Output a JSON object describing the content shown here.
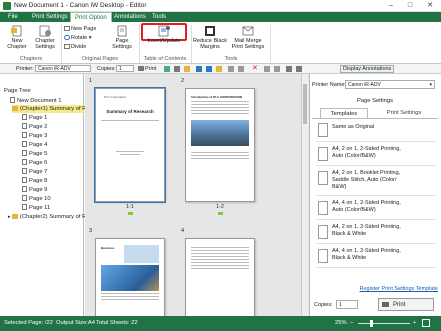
{
  "window": {
    "title": "New Document 1 - Canon iW Desktop - Editor"
  },
  "tabs": [
    "File",
    "Print Settings",
    "Print Option",
    "Annotations",
    "Tools"
  ],
  "ribbon": {
    "new_chapter": "New\nChapter",
    "chapter_settings": "Chapter\nSettings",
    "group_chapters": "Chapters",
    "new_page": "New Page",
    "rotate": "Rotate",
    "divide": "Divide",
    "page_settings": "Page\nSettings",
    "group_original_pages": "Original Pages",
    "insert_update": "Insert/Update",
    "group_table_of_contents": "Table of Contents",
    "reduce_black_margins": "Reduce Black\nMargins",
    "mail_merge_print_settings": "Mail Merge\nPrint Settings",
    "group_tools": "Tools"
  },
  "toolbar": {
    "printer_label": "Printer:",
    "printer_value": "Canon iR-ADV",
    "copies_label": "Copies:",
    "copies_value": "1",
    "print_label": "Print",
    "display_annotations": "Display Annotations"
  },
  "page_tree": {
    "title": "Page Tree",
    "root": "New Document 1",
    "chapter1": "(Chapter1) Summary of Re",
    "pages": [
      "Page 1",
      "Page 2",
      "Page 3",
      "Page 4",
      "Page 5",
      "Page 6",
      "Page 7",
      "Page 8",
      "Page 9",
      "Page 10",
      "Page 11"
    ],
    "chapter2": "(Chapter2) Summary of Re"
  },
  "center": {
    "labels": [
      "1",
      "2",
      "3",
      "4"
    ],
    "page_labels": [
      "1-1",
      "1-2"
    ],
    "page1_title": "Summary of Research",
    "page1_company": "PLC Corporation",
    "page2_heading": "Introduction of PLC CORPORATION",
    "page3_heading": "Business"
  },
  "right": {
    "printer_name_label": "Printer Name:",
    "printer_name_value": "Canon iR-ADV",
    "page_settings_title": "Page Settings",
    "tab_templates": "Templates",
    "tab_print_settings": "Print Settings",
    "templates": [
      "Same as Original",
      "A4, 2 on 1, 2-Sided Printing,\nAuto (Color/B&W)",
      "A4, 2 on 1, Booklet Printing,\nSaddle Stitch, Auto (Color/\nB&W)",
      "A4, 4 on 1, 2-Sided Printing,\nAuto (Color/B&W)",
      "A4, 2 on 1, 2-Sided Printing,\nBlack & White",
      "A4, 4 on 1, 2-Sided Printing,\nBlack & White"
    ],
    "register_link": "Register Print Settings Template",
    "copies_label": "Copies:",
    "copies_value": "1",
    "print_button": "Print"
  },
  "status": {
    "selected_page": "Selected Page: /22",
    "output_size": "Output Size:A4",
    "total_sheets": "Total Sheets: 22",
    "zoom": "25%"
  },
  "colors": {
    "accent": "#217346",
    "highlight": "#e02020",
    "selection": "#2d79c7"
  }
}
